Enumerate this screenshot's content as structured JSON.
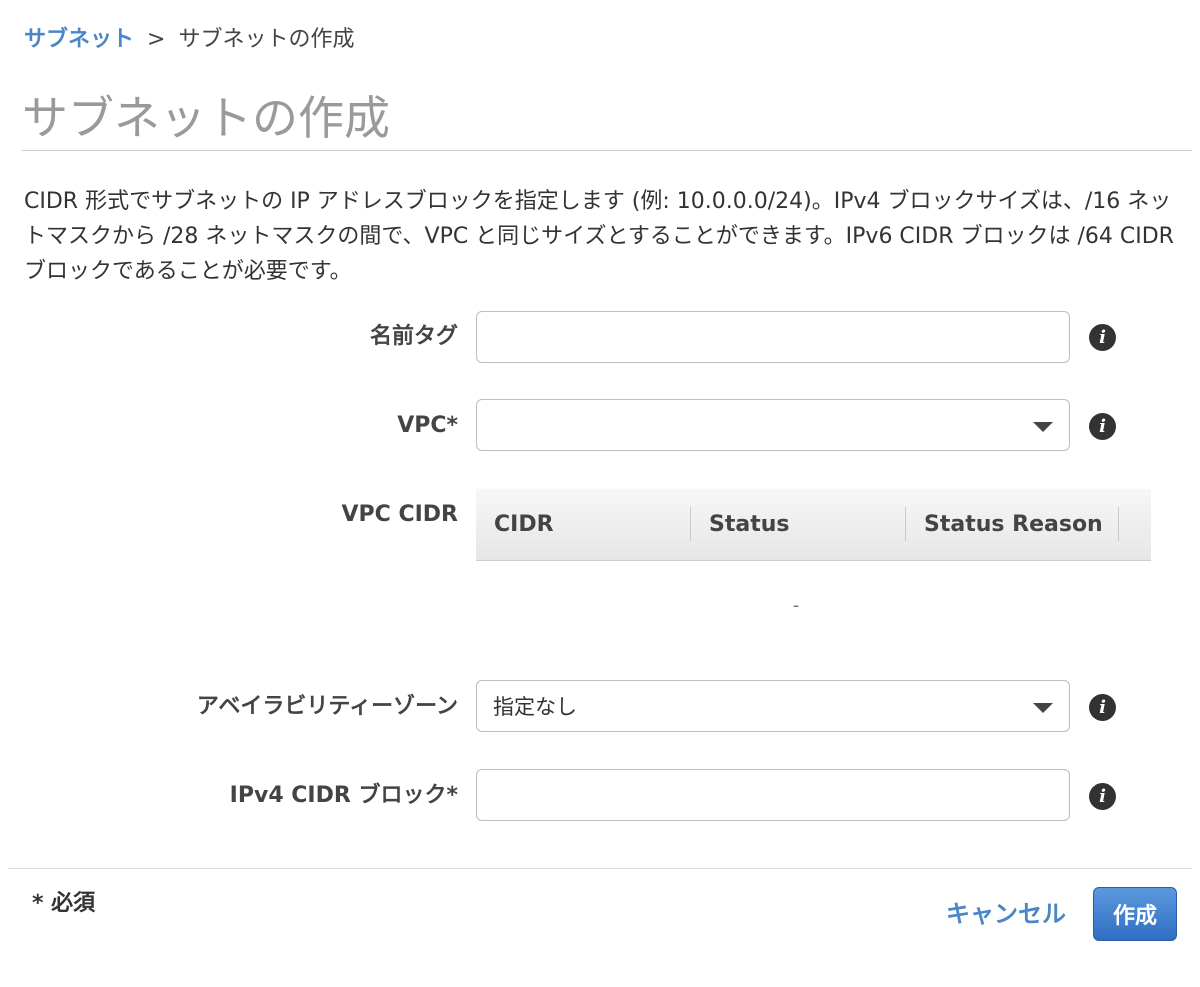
{
  "breadcrumb": {
    "parent": "サブネット",
    "separator": ">",
    "current": "サブネットの作成"
  },
  "page_title": "サブネットの作成",
  "description": "CIDR 形式でサブネットの IP アドレスブロックを指定します (例: 10.0.0.0/24)。IPv4 ブロックサイズは、/16 ネットマスクから /28 ネットマスクの間で、VPC と同じサイズとすることができます。IPv6 CIDR ブロックは /64 CIDR ブロックであることが必要です。",
  "form": {
    "name_tag": {
      "label": "名前タグ",
      "value": ""
    },
    "vpc": {
      "label": "VPC*",
      "selected": ""
    },
    "vpc_cidr": {
      "label": "VPC CIDR",
      "columns": [
        "CIDR",
        "Status",
        "Status Reason"
      ],
      "empty_text": "-"
    },
    "availability_zone": {
      "label": "アベイラビリティーゾーン",
      "selected": "指定なし"
    },
    "ipv4_cidr": {
      "label": "IPv4 CIDR ブロック*",
      "value": ""
    }
  },
  "footer": {
    "required_note": "* 必須",
    "cancel_label": "キャンセル",
    "create_label": "作成"
  },
  "icons": {
    "info": "info-icon",
    "dropdown": "caret-down-icon"
  },
  "colors": {
    "link": "#4a86c8",
    "primary_button": "#2f6fc3",
    "title": "#9a9a9a"
  }
}
